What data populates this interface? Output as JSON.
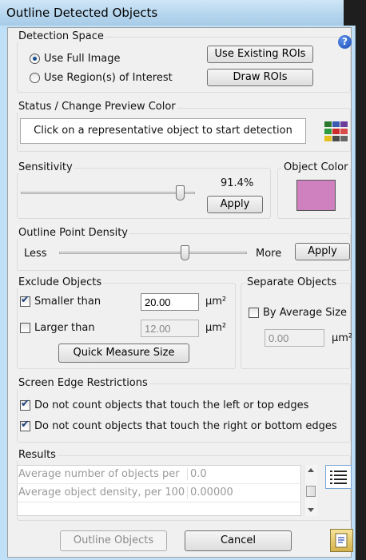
{
  "window": {
    "title": "Outline Detected Objects"
  },
  "detection_space": {
    "label": "Detection Space",
    "options": [
      "Use Full Image",
      "Use Region(s) of Interest"
    ],
    "selected_index": 0,
    "use_existing_rois": "Use Existing ROIs",
    "draw_rois": "Draw ROIs",
    "help_icon": "?"
  },
  "status": {
    "label": "Status / Change Preview Color",
    "message": "Click on a representative object to start detection",
    "palette_colors": [
      "#2b7a2b",
      "#3b5bb0",
      "#6a3d9a",
      "#2c9c3f",
      "#d02b2b",
      "#d94a4a",
      "#e6c01a",
      "#4a4a4a",
      "#666666"
    ]
  },
  "sensitivity": {
    "label": "Sensitivity",
    "value_text": "91.4%",
    "value": 0.914,
    "apply": "Apply"
  },
  "object_color": {
    "label": "Object Color",
    "color": "#cf80bf"
  },
  "point_density": {
    "label": "Outline Point Density",
    "less": "Less",
    "more": "More",
    "value": 0.67,
    "apply": "Apply"
  },
  "exclude": {
    "label": "Exclude Objects",
    "smaller_label": "Smaller than",
    "smaller_checked": true,
    "smaller_value": "20.00",
    "larger_label": "Larger than",
    "larger_checked": false,
    "larger_value": "12.00",
    "unit": "µm²",
    "quick_measure": "Quick Measure Size"
  },
  "separate": {
    "label": "Separate Objects",
    "by_average": "By Average Size",
    "checked": false,
    "value": "0.00",
    "unit": "µm²"
  },
  "edges": {
    "label": "Screen Edge Restrictions",
    "left_top": "Do not count objects that touch the left or top edges",
    "right_bottom": "Do not count objects that touch the right or bottom edges",
    "left_top_checked": true,
    "right_bottom_checked": true
  },
  "results": {
    "label": "Results",
    "rows": [
      {
        "name": "Average number of objects per",
        "value": "0.0"
      },
      {
        "name": "Average object density, per 100",
        "value": "0.00000"
      }
    ]
  },
  "footer": {
    "outline_objects": "Outline Objects",
    "cancel": "Cancel"
  }
}
